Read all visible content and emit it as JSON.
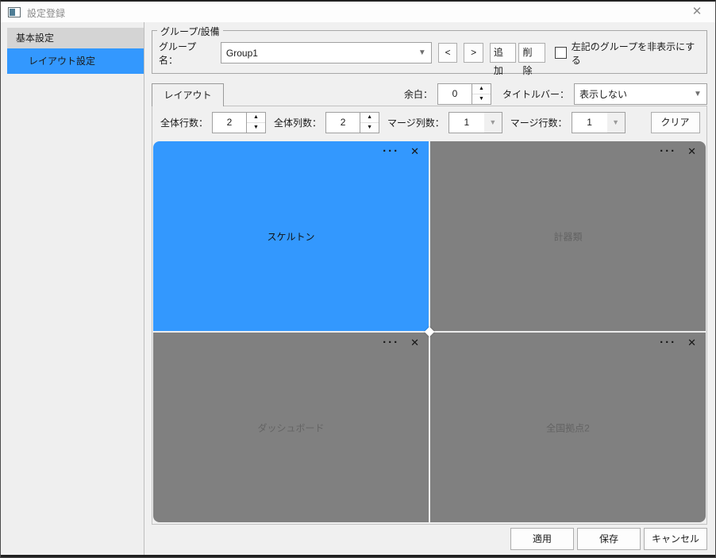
{
  "window": {
    "title": "設定登録",
    "close_icon": "✕"
  },
  "sidebar": {
    "items": [
      {
        "label": "基本設定",
        "selected": false
      },
      {
        "label": "レイアウト設定",
        "selected": true
      }
    ]
  },
  "group_box": {
    "legend": "グループ/設備",
    "group_name_label": "グループ名：",
    "group_name_value": "Group1",
    "prev_label": "<",
    "next_label": ">",
    "add_label": "追加",
    "delete_label": "削除",
    "hide_checkbox_label": "左記のグループを非表示にする",
    "hide_checkbox_checked": false
  },
  "layout_tab": {
    "tab_label": "レイアウト",
    "margin_label": "余白：",
    "margin_value": "0",
    "titlebar_label": "タイトルバー：",
    "titlebar_value": "表示しない",
    "rows_label": "全体行数：",
    "rows_value": "2",
    "cols_label": "全体列数：",
    "cols_value": "2",
    "merge_cols_label": "マージ列数：",
    "merge_cols_value": "1",
    "merge_rows_label": "マージ行数：",
    "merge_rows_value": "1",
    "clear_label": "クリア"
  },
  "grid": {
    "rows": 2,
    "cols": 2,
    "panel_menu_icon": "···",
    "panel_close_icon": "✕",
    "panels": [
      {
        "label": "スケルトン",
        "selected": true
      },
      {
        "label": "計器類",
        "selected": false
      },
      {
        "label": "ダッシュボード",
        "selected": false
      },
      {
        "label": "全国拠点2",
        "selected": false
      }
    ]
  },
  "footer": {
    "apply_label": "適用",
    "save_label": "保存",
    "cancel_label": "キャンセル"
  },
  "colors": {
    "accent_blue": "#3398fe",
    "panel_gray": "#808080",
    "panel_label_gray": "#636363",
    "window_bg": "#f0f0f0",
    "sidebar_item_bg": "#d4d4d4",
    "titlebar_bg": "#fdfdfd"
  }
}
